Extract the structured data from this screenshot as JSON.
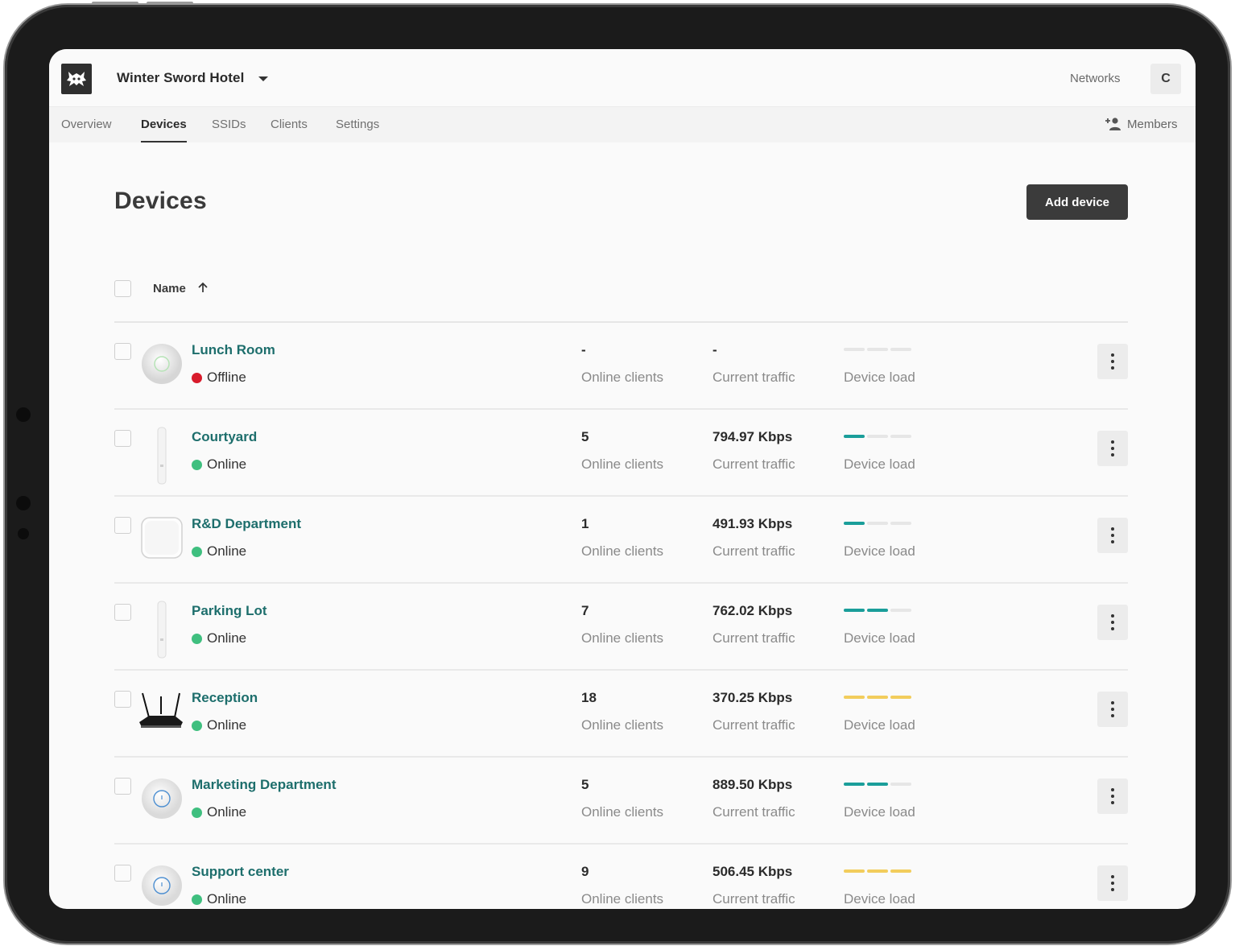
{
  "header": {
    "org_name": "Winter Sword Hotel",
    "networks_label": "Networks",
    "avatar_initial": "C"
  },
  "tabs": [
    {
      "label": "Overview",
      "active": false
    },
    {
      "label": "Devices",
      "active": true
    },
    {
      "label": "SSIDs",
      "active": false
    },
    {
      "label": "Clients",
      "active": false
    },
    {
      "label": "Settings",
      "active": false
    }
  ],
  "members_label": "Members",
  "page": {
    "title": "Devices",
    "add_button": "Add device"
  },
  "table": {
    "sort_column": "Name",
    "clients_label": "Online clients",
    "traffic_label": "Current traffic",
    "load_label": "Device load"
  },
  "colors": {
    "online": "#3fbf7f",
    "offline": "#d81b2b",
    "load_normal": "#1a9e9a",
    "load_high": "#f2cd5c",
    "load_empty": "#e6e6e6",
    "name_link": "#1d6e6c"
  },
  "devices": [
    {
      "name": "Lunch Room",
      "status": "Offline",
      "clients": "-",
      "traffic": "-",
      "load_level": 0,
      "load_state": "empty",
      "thumb": "round-ap-icon"
    },
    {
      "name": "Courtyard",
      "status": "Online",
      "clients": "5",
      "traffic": "794.97 Kbps",
      "load_level": 1,
      "load_state": "normal",
      "thumb": "outdoor-mesh-icon"
    },
    {
      "name": "R&D Department",
      "status": "Online",
      "clients": "1",
      "traffic": "491.93 Kbps",
      "load_level": 1,
      "load_state": "normal",
      "thumb": "square-ap-icon"
    },
    {
      "name": "Parking Lot",
      "status": "Online",
      "clients": "7",
      "traffic": "762.02 Kbps",
      "load_level": 2,
      "load_state": "normal",
      "thumb": "outdoor-mesh-icon"
    },
    {
      "name": "Reception",
      "status": "Online",
      "clients": "18",
      "traffic": "370.25 Kbps",
      "load_level": 3,
      "load_state": "high",
      "thumb": "router-icon"
    },
    {
      "name": "Marketing Department",
      "status": "Online",
      "clients": "5",
      "traffic": "889.50 Kbps",
      "load_level": 2,
      "load_state": "normal",
      "thumb": "disc-ap-icon"
    },
    {
      "name": "Support center",
      "status": "Online",
      "clients": "9",
      "traffic": "506.45 Kbps",
      "load_level": 3,
      "load_state": "high",
      "thumb": "disc-ap-icon"
    }
  ]
}
